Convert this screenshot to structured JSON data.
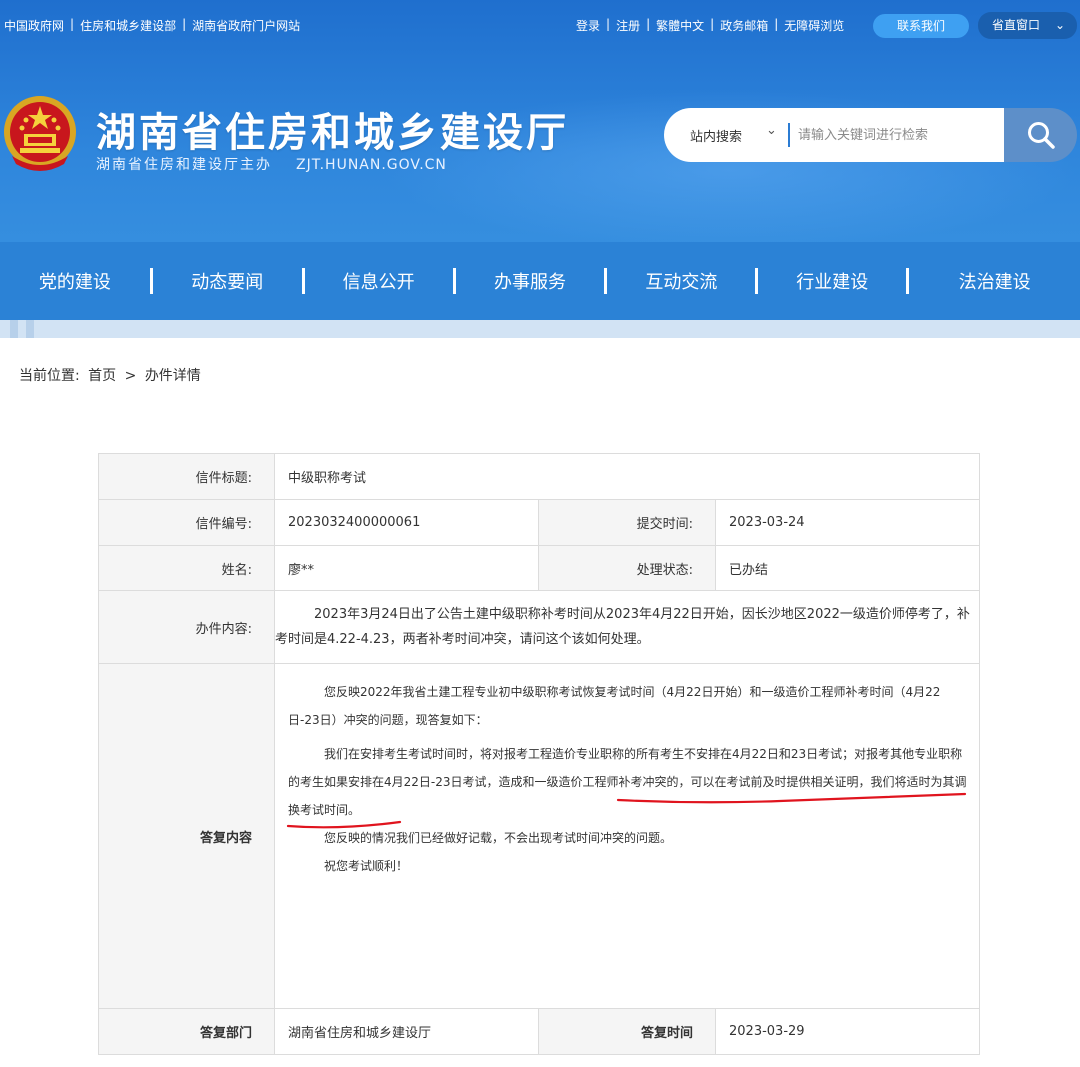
{
  "header": {
    "top_left_links": [
      "中国政府网",
      "住房和城乡建设部",
      "湖南省政府门户网站"
    ],
    "top_right_links": [
      "登录",
      "注册",
      "繁體中文",
      "政务邮箱",
      "无障碍浏览"
    ],
    "contact_button": "联系我们",
    "province_window_button": "省直窗口",
    "site_title": "湖南省住房和城乡建设厅",
    "site_subtitle": "湖南省住房和建设厅主办",
    "site_domain": "ZJT.HUNAN.GOV.CN",
    "search": {
      "scope": "站内搜索",
      "placeholder": "请输入关键词进行检索"
    }
  },
  "nav": {
    "items": [
      "党的建设",
      "动态要闻",
      "信息公开",
      "办事服务",
      "互动交流",
      "行业建设",
      "法治建设"
    ]
  },
  "breadcrumb": {
    "prefix": "当前位置:",
    "home": "首页",
    "sep": ">",
    "current": "办件详情"
  },
  "detail": {
    "title_label": "信件标题:",
    "title_value": "中级职称考试",
    "number_label": "信件编号:",
    "number_value": "2023032400000061",
    "submit_time_label": "提交时间:",
    "submit_time_value": "2023-03-24",
    "name_label": "姓名:",
    "name_value": "廖**",
    "status_label": "处理状态:",
    "status_value": "已办结",
    "content_label": "办件内容:",
    "content_value": "2023年3月24日出了公告土建中级职称补考时间从2023年4月22日开始，因长沙地区2022一级造价师停考了，补考时间是4.22-4.23，两者补考时间冲突，请问这个该如何处理。",
    "reply_label": "答复内容",
    "reply_paragraphs": [
      "您反映2022年我省土建工程专业初中级职称考试恢复考试时间（4月22日开始）和一级造价工程师补考时间（4月22日-23日）冲突的问题，现答复如下：",
      "我们在安排考生考试时间时，将对报考工程造价专业职称的所有考生不安排在4月22日和23日考试；对报考其他专业职称的考生如果安排在4月22日-23日考试，造成和一级造价工程师补考冲突的，可以在考试前及时提供相关证明，我们将适时为其调换考试时间。",
      "您反映的情况我们已经做好记载，不会出现考试时间冲突的问题。",
      "祝您考试顺利！"
    ],
    "dept_label": "答复部门",
    "dept_value": "湖南省住房和城乡建设厅",
    "reply_time_label": "答复时间",
    "reply_time_value": "2023-03-29"
  },
  "colors": {
    "banner_top": "#1f6fce",
    "nav": "#2b82d6",
    "underline": "#e0141e"
  }
}
